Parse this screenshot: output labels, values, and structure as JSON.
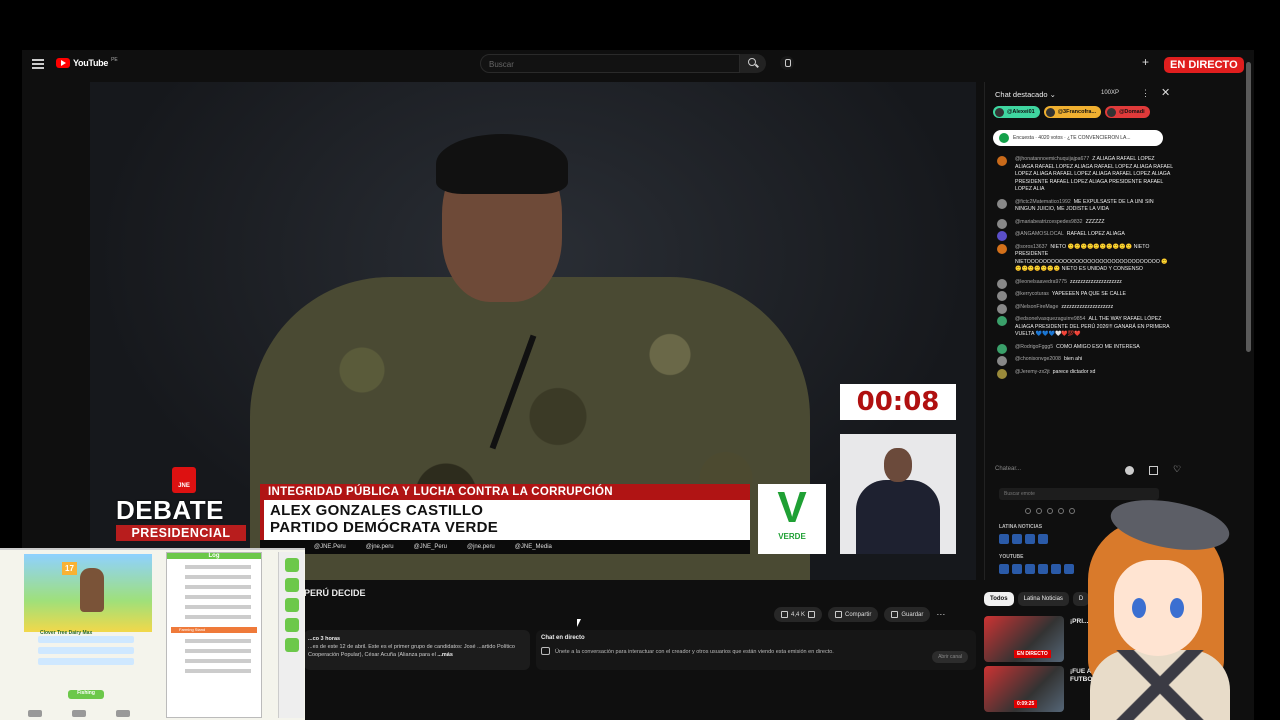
{
  "browser": {
    "logo": "YouTube",
    "region": "PE",
    "search_placeholder": "Buscar",
    "live_badge": "EN DIRECTO"
  },
  "video": {
    "timer": "00:08",
    "event_org": "JNE",
    "debate_title": "DEBATE",
    "debate_sub": "PRESIDENCIAL",
    "topic": "INTEGRIDAD PÚBLICA Y LUCHA CONTRA LA CORRUPCIÓN",
    "speaker_name": "ALEX GONZALES CASTILLO",
    "speaker_party": "PARTIDO DEMÓCRATA VERDE",
    "social": [
      "@JNE.Peru",
      "@jne.peru",
      "@JNE_Peru",
      "@jne.peru",
      "@JNE_Media"
    ],
    "party_logo_letter": "V",
    "party_logo_name": "VERDE"
  },
  "below": {
    "title": "PERÚ DECIDE",
    "actions": {
      "likes": "4,4 K",
      "share": "Compartir",
      "save": "Guardar"
    },
    "desc_meta": "...co 3 horas",
    "desc_text": "...es de este 12 de abril. Este es el primer grupo de candidatos: José ...artido Político Cooperación Popular), César Acuña (Alianza para el",
    "desc_more": "...más",
    "chat_title": "Chat en directo",
    "chat_text": "Únete a la conversación para interactuar con el creador y otros usuarios que están viendo esta emisión en directo.",
    "chat_button": "Abrir canal"
  },
  "chat": {
    "header": "Chat destacado",
    "xp": "100XP",
    "pinned": [
      {
        "name": "@Alexei01",
        "color": "#3fd6a0"
      },
      {
        "name": "@3Francofra...",
        "color": "#f0b030"
      },
      {
        "name": "@Domadi",
        "color": "#e03a3a"
      }
    ],
    "poll": "Encuesta · 4020 votos · ¿TE CONVENCIERON LA...",
    "messages": [
      {
        "user": "@jhonatannoemichuquijajpa677",
        "text": "Z ALIAGA RAFAEL LOPEZ ALIAGA RAFAEL LOPEZ ALIAGA RAFAEL LOPEZ ALIAGA RAFAEL LOPEZ ALIAGA RAFAEL LOPEZ ALIAGA RAFAEL LOPEZ ALIAGA PRESIDENTE RAFAEL LOPEZ ALIAGA PRESIDENTE RAFAEL LOPEZ ALIA",
        "color": "#c96a1a"
      },
      {
        "user": "@fictc2Matematico1992",
        "text": "ME EXPULSASTE DE LA UNI SIN NINGUN JUICIO, ME JODISTE LA VIDA",
        "color": "#888"
      },
      {
        "user": "@mariabeatrizcespedes9832",
        "text": "ZZZZZZ",
        "color": "#888"
      },
      {
        "user": "@ANGAMOSLOCAL",
        "text": "RAFAEL LOPEZ ALIAGA",
        "color": "#5b4fc9"
      },
      {
        "user": "@soros13637",
        "text": "NIETO 🙂🙂🙂🙂🙂🙂🙂🙂🙂🙂 NIETO PRESIDENTE NIETOOOOOOOOOOOOOOOOOOOOOOOOOOOOOOOOO 🙂🙂🙂🙂🙂🙂🙂🙂 NIETO ES UNIDAD Y CONSENSO",
        "color": "#d3701a"
      },
      {
        "user": "@leonelsaavedra9775",
        "text": "zzzzzzzzzzzzzzzzzzzz",
        "color": "#888"
      },
      {
        "user": "@kerrycoturas",
        "text": "YAPEEEEN PA QUE SE CALLE",
        "color": "#888"
      },
      {
        "user": "@NelsonFireMage",
        "text": "zzzzzzzzzzzzzzzzzzzz",
        "color": "#888"
      },
      {
        "user": "@edsonelvasquezaguirre9854",
        "text": "ALL THE WAY RAFAEL LÓPEZ ALIAGA PRESIDENTE DEL PERÚ 2026!!! GANARÁ EN PRIMERA VUELTA 💙💙💙🤍❤️💯❤️",
        "color": "#3aa06a"
      },
      {
        "user": "@RodrigoFggg5",
        "text": "COMO AMIGO ESO ME INTERESA",
        "color": "#3aa06a"
      },
      {
        "user": "@chonisonvge2008",
        "text": "bien ahi",
        "color": "#888"
      },
      {
        "user": "@Jeremy-zx2jt",
        "text": "parece dictador xd",
        "color": "#9a8a3a"
      }
    ],
    "input_placeholder": "Chatear...",
    "search_placeholder": "Buscar emote",
    "section_1": "LATINA NOTICIAS",
    "section_2": "YOUTUBE"
  },
  "related": {
    "tabs": [
      "Todos",
      "Latina Noticias",
      "D"
    ],
    "items": [
      {
        "title": "¡PRI... ¿POR...",
        "label": "EN DIRECTO"
      },
      {
        "title": "¡FUE AMA... FUTBOLI...",
        "label": "0:09:25"
      }
    ]
  },
  "overlay": {
    "level": "17",
    "panel_header": "Log",
    "panel_tab": "Farming Stand",
    "button": "Fishing",
    "caption": "Clover Tree Dairy Max"
  },
  "colors": {
    "live_red": "#e01e1e",
    "jne_red": "#b01414",
    "verde_green": "#1fa034"
  }
}
